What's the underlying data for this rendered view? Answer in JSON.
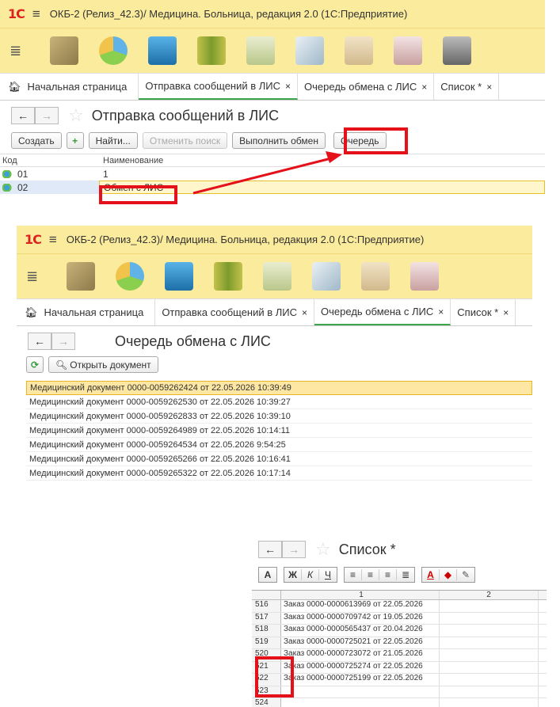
{
  "app": {
    "logo": "1С",
    "window_title": "ОКБ-2 (Релиз_42.3)/  Медицина. Больница, редакция 2.0  (1С:Предприятие)"
  },
  "toolbar_icons": [
    "money-icon",
    "pie-chart-icon",
    "building-icon",
    "folders-icon",
    "help-clipboard-icon",
    "documents-icon",
    "certificate-icon",
    "medkit-icon",
    "printer-icon"
  ],
  "tabs": {
    "home": "Начальная страница",
    "send": "Отправка сообщений в ЛИС",
    "queue": "Очередь обмена с ЛИС",
    "list": "Список *",
    "close": "×"
  },
  "panel1": {
    "form_title": "Отправка сообщений в ЛИС",
    "buttons": {
      "create": "Создать",
      "find": "Найти...",
      "cancel_search": "Отменить поиск",
      "exchange": "Выполнить обмен",
      "queue": "Очередь"
    },
    "columns": {
      "code": "Код",
      "name": "Наименование"
    },
    "rows": [
      {
        "code": "01",
        "name": "1"
      },
      {
        "code": "02",
        "name": "Обмен с ЛИС"
      }
    ]
  },
  "panel2": {
    "form_title": "Очередь обмена с ЛИС",
    "open_doc": "Открыть документ",
    "rows": [
      "Медицинский документ 0000-0059262424 от 22.05.2026 10:39:49",
      "Медицинский документ 0000-0059262530 от 22.05.2026 10:39:27",
      "Медицинский документ 0000-0059262833 от 22.05.2026 10:39:10",
      "Медицинский документ 0000-0059264989 от 22.05.2026 10:14:11",
      "Медицинский документ 0000-0059264534 от 22.05.2026 9:54:25",
      "Медицинский документ 0000-0059265266 от 22.05.2026 10:16:41",
      "Медицинский документ 0000-0059265322 от 22.05.2026 10:17:14"
    ]
  },
  "panel3": {
    "form_title": "Список *",
    "fmt": {
      "font": "А",
      "bold": "Ж",
      "italic": "К",
      "underline": "Ч",
      "font_color": "А"
    },
    "col_headers": [
      "1",
      "2"
    ],
    "rows": [
      {
        "n": "516",
        "text": "Заказ 0000-0000613969 от 22.05.2026"
      },
      {
        "n": "517",
        "text": "Заказ 0000-0000709742 от 19.05.2026"
      },
      {
        "n": "518",
        "text": "Заказ 0000-0000565437 от 20.04.2026"
      },
      {
        "n": "519",
        "text": "Заказ 0000-0000725021 от 22.05.2026"
      },
      {
        "n": "520",
        "text": "Заказ 0000-0000723072 от 21.05.2026"
      },
      {
        "n": "521",
        "text": "Заказ 0000-0000725274 от 22.05.2026"
      },
      {
        "n": "522",
        "text": "Заказ 0000-0000725199 от 22.05.2026"
      },
      {
        "n": "523",
        "text": ""
      },
      {
        "n": "524",
        "text": ""
      }
    ]
  },
  "colors": {
    "header_bg": "#fbeb9d",
    "highlight": "#e4101a",
    "active_tab": "#3ea54a",
    "selection": "#fde7a2"
  }
}
